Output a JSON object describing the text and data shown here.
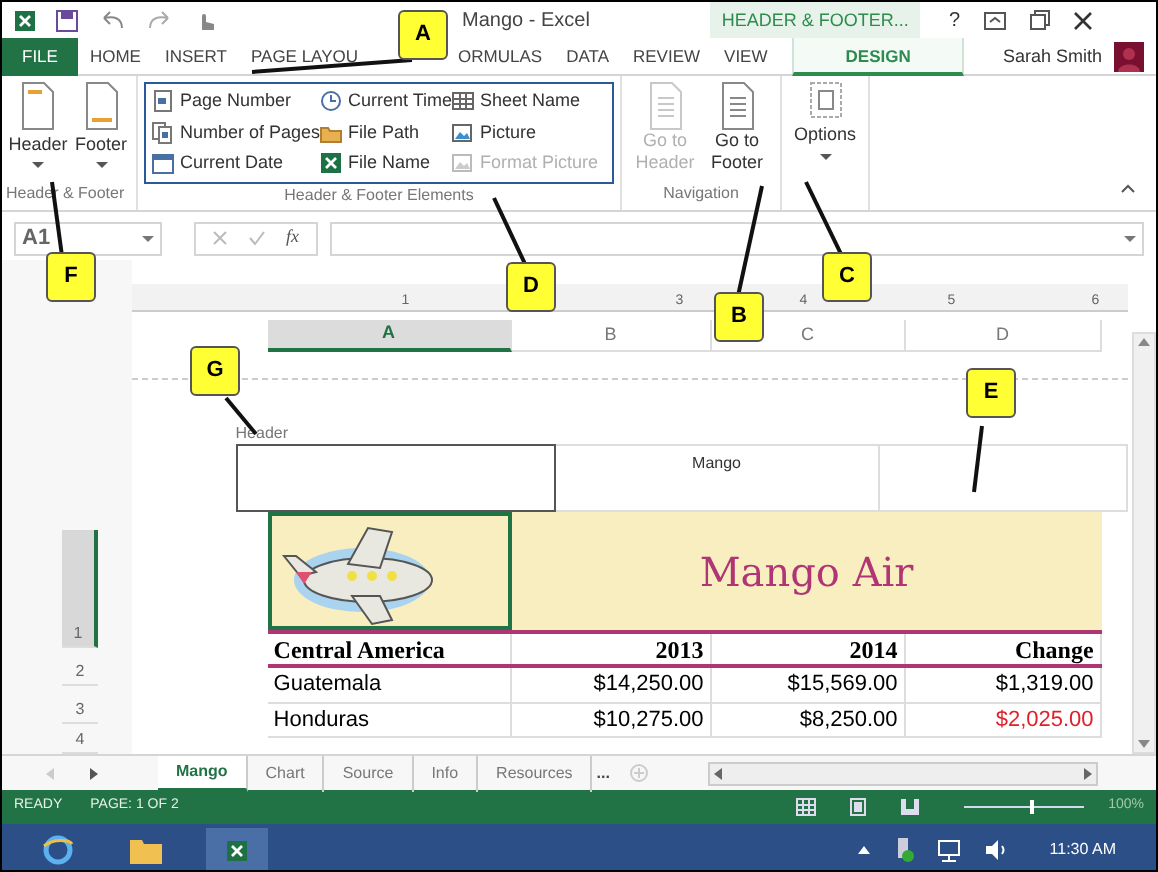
{
  "title_bar": {
    "title": "Mango - Excel",
    "context_tab": "HEADER & FOOTER...",
    "help": "?"
  },
  "ribbon_tabs": [
    {
      "label": "FILE",
      "kind": "file",
      "selected": false
    },
    {
      "label": "HOME",
      "kind": "plain",
      "selected": false
    },
    {
      "label": "INSERT",
      "kind": "plain",
      "selected": false
    },
    {
      "label": "PAGE LAYOU",
      "kind": "plain",
      "selected": false
    },
    {
      "label": "ORMULAS",
      "kind": "plain",
      "selected": false
    },
    {
      "label": "DATA",
      "kind": "plain",
      "selected": false
    },
    {
      "label": "REVIEW",
      "kind": "plain",
      "selected": false
    },
    {
      "label": "VIEW",
      "kind": "plain",
      "selected": false
    },
    {
      "label": "DESIGN",
      "kind": "context",
      "selected": true
    }
  ],
  "user": {
    "name": "Sarah Smith"
  },
  "header_footer_group": {
    "name": "Header & Footer",
    "buttons": [
      {
        "label": "Header"
      },
      {
        "label": "Footer"
      }
    ]
  },
  "elements_group": {
    "name": "Header & Footer Elements",
    "items": [
      {
        "label": "Page Number",
        "disabled": false
      },
      {
        "label": "Current Time",
        "disabled": false
      },
      {
        "label": "Sheet Name",
        "disabled": false
      },
      {
        "label": "Number of Pages",
        "disabled": false
      },
      {
        "label": "File Path",
        "disabled": false
      },
      {
        "label": "Picture",
        "disabled": false
      },
      {
        "label": "Current Date",
        "disabled": false
      },
      {
        "label": "File Name",
        "disabled": false
      },
      {
        "label": "Format Picture",
        "disabled": true
      }
    ]
  },
  "navigation_group": {
    "name": "Navigation",
    "buttons": [
      {
        "line1": "Go to",
        "line2": "Header",
        "disabled": true
      },
      {
        "line1": "Go to",
        "line2": "Footer",
        "disabled": false
      }
    ]
  },
  "options_group": {
    "button": "Options"
  },
  "formula_bar": {
    "name_box": "A1",
    "function_label": "fx"
  },
  "ruler": [
    "1",
    "3",
    "4",
    "5",
    "6"
  ],
  "columns": [
    {
      "label": "A",
      "selected": true
    },
    {
      "label": "B",
      "selected": false
    },
    {
      "label": "C",
      "selected": false
    },
    {
      "label": "D",
      "selected": false
    }
  ],
  "page_header": {
    "label": "Header",
    "center": "Mango"
  },
  "title_row": {
    "number": "1",
    "title": "Mango Air"
  },
  "table_header": {
    "number": "2",
    "cells": [
      "Central America",
      "2013",
      "2014",
      "Change"
    ]
  },
  "rows": [
    {
      "number": "3",
      "cells": [
        "Guatemala",
        "$14,250.00",
        "$15,569.00",
        "$1,319.00"
      ],
      "negative": false
    },
    {
      "number": "4",
      "cells": [
        "Honduras",
        "$10,275.00",
        "$8,250.00",
        "$2,025.00"
      ],
      "negative": true
    }
  ],
  "sheet_tabs": [
    {
      "label": "Mango",
      "selected": true
    },
    {
      "label": "Chart",
      "selected": false
    },
    {
      "label": "Source",
      "selected": false
    },
    {
      "label": "Info",
      "selected": false
    },
    {
      "label": "Resources",
      "selected": false
    }
  ],
  "sheet_tabs_more": "...",
  "status_bar": {
    "state": "READY",
    "page": "PAGE: 1 OF 2",
    "zoom": "100%",
    "zoom_slider": {
      "level": 0.55
    }
  },
  "taskbar": {
    "clock": "11:30 AM"
  },
  "callouts": [
    "A",
    "B",
    "C",
    "D",
    "E",
    "F",
    "G"
  ]
}
